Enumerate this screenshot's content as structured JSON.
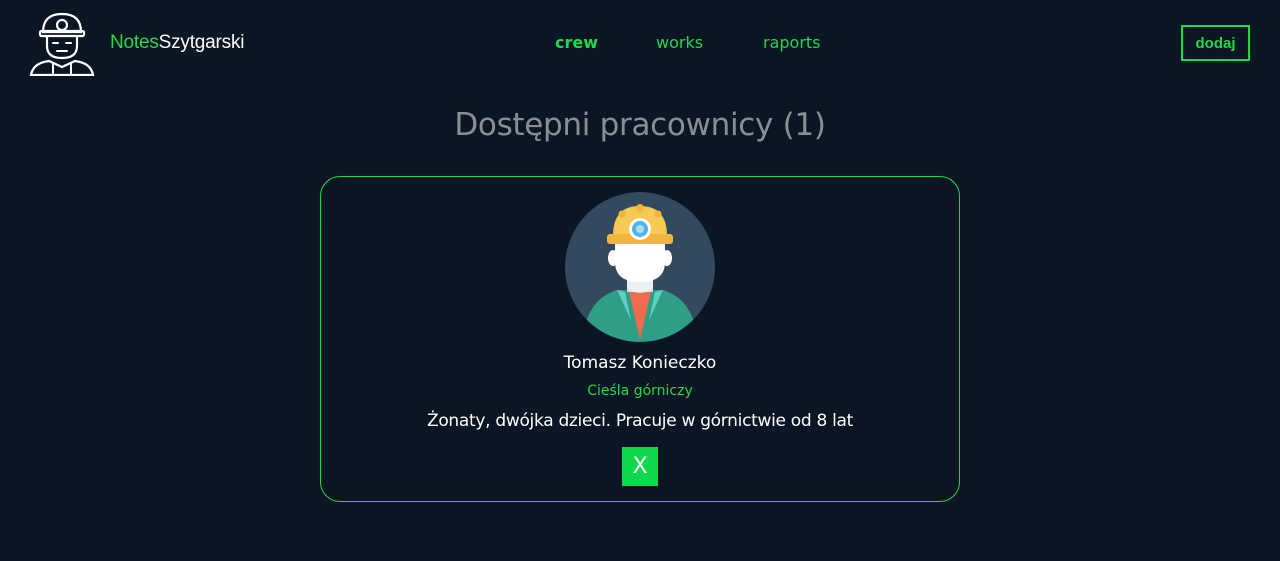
{
  "header": {
    "brand_notes": "Notes",
    "brand_name": "Szytgarski",
    "logo_icon": "miner-icon"
  },
  "nav": {
    "items": [
      {
        "label": "crew",
        "active": true
      },
      {
        "label": "works",
        "active": false
      },
      {
        "label": "raports",
        "active": false
      }
    ]
  },
  "actions": {
    "add_label": "dodaj"
  },
  "main": {
    "title": "Dostępni pracownicy (1)"
  },
  "workers": [
    {
      "name": "Tomasz Konieczko",
      "role": "Cieśla górniczy",
      "description": "Żonaty, dwójka dzieci. Pracuje w górnictwie od 8 lat",
      "avatar_icon": "miner-avatar-icon",
      "remove_label": "X"
    }
  ],
  "colors": {
    "background": "#0b1624",
    "accent": "#1fd94a",
    "title": "#8a8e93",
    "text": "#ffffff"
  }
}
